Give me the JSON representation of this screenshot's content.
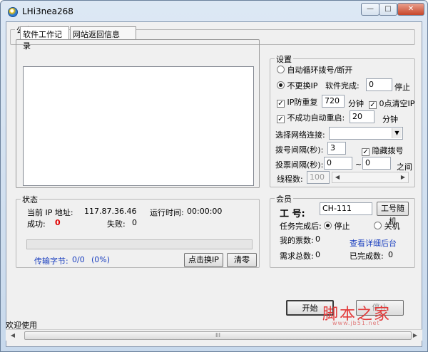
{
  "window": {
    "title": "LHi3nea268",
    "min_glyph": "—",
    "max_glyph": "□",
    "close_glyph": "✕"
  },
  "notice": {
    "label": "公告"
  },
  "tabs": [
    {
      "label": "软件工作记录"
    },
    {
      "label": "网站返回信息"
    }
  ],
  "settings": {
    "label": "设置",
    "auto_cycle_label": "自动循环拨号/断开",
    "no_change_ip_label": "不更换IP",
    "software_done_label": "软件完成:",
    "software_done_value": "0",
    "stop_label": "停止",
    "ip_guard_label": "IP防重复",
    "ip_guard_value": "720",
    "minute_label": "分钟",
    "clear_ip_label": "0点清空IP",
    "auto_restart_label": "不成功自动重启:",
    "auto_restart_value": "20",
    "minute_label2": "分钟",
    "network_label": "选择网络连接:",
    "network_value": "",
    "dial_interval_label": "拨号间隔(秒):",
    "dial_interval_value": "3",
    "hide_dial_label": "隐藏拨号",
    "vote_interval_label": "投票间隔(秒):",
    "vote_from": "0",
    "vote_tilde": "~",
    "vote_to": "0",
    "between_label": "之间",
    "threads_label": "线程数:",
    "threads_value": "100"
  },
  "status": {
    "label": "状态",
    "ip_label": "当前 IP 地址:",
    "ip_value": "117.87.36.46",
    "runtime_label": "运行时间:",
    "runtime_value": "00:00:00",
    "success_label": "成功:",
    "success_value": "0",
    "fail_label": "失败:",
    "fail_value": "0",
    "transfer_label": "传输字节:",
    "transfer_value": "0/0",
    "transfer_pct": "(0%)",
    "progress": 0,
    "change_ip_button": "点击换IP",
    "clear_button": "清零"
  },
  "member": {
    "label": "会员",
    "id_label": "工  号:",
    "id_value": "CH-111",
    "random_id_button": "工号随机",
    "after_done_label": "任务完成后:",
    "opt_stop": "停止",
    "opt_shutdown": "关机",
    "my_votes_label": "我的票数:",
    "my_votes_value": "0",
    "backend_link": "查看详细后台",
    "total_need_label": "需求总数:",
    "total_need_value": "0",
    "done_label": "已完成数:",
    "done_value": "0"
  },
  "actions": {
    "start_button": "开始",
    "stop_button": "停止"
  },
  "statusbar": {
    "text": "欢迎使用"
  },
  "hscroll": {
    "grip": "III"
  },
  "watermark": {
    "main": "脚本之家",
    "sub": "www.jb51.net"
  },
  "colors": {
    "success_red": "#e00000",
    "link_blue": "#1a3fbf",
    "progress_green": "#37b34a"
  }
}
